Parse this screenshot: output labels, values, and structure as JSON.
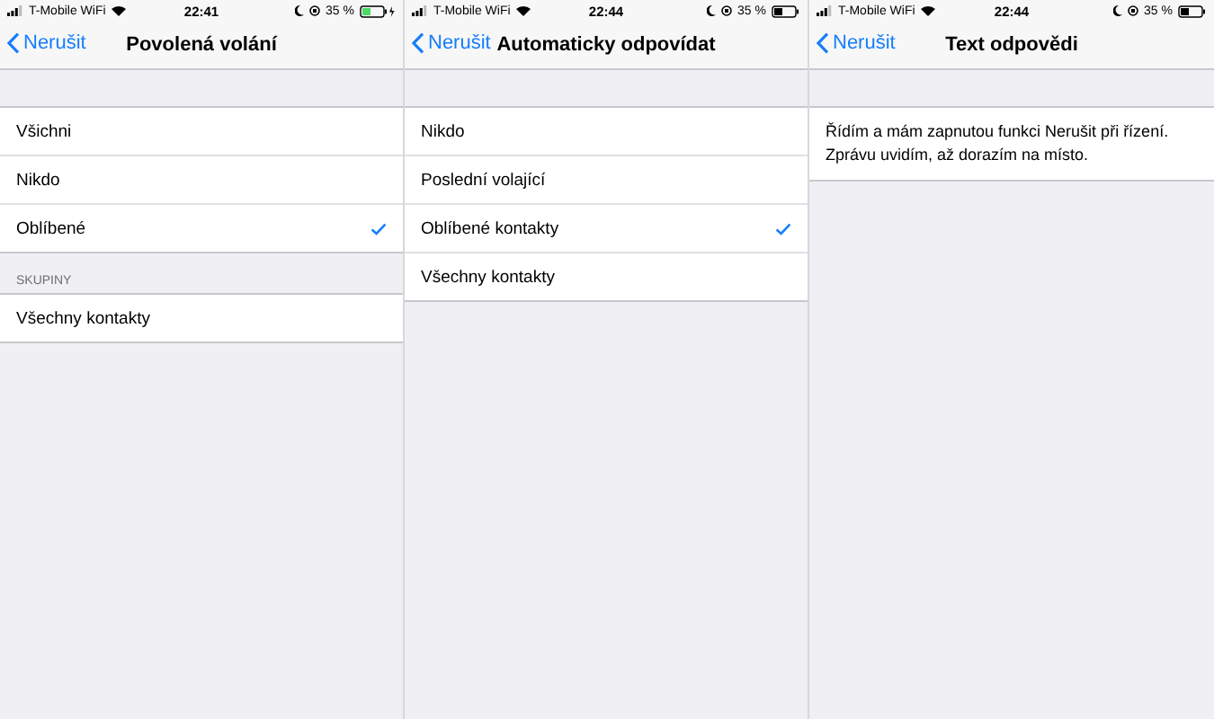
{
  "panels": [
    {
      "status_bar": {
        "carrier": "T-Mobile WiFi",
        "time": "22:41",
        "battery": "35 %",
        "charging": true
      },
      "nav": {
        "back": "Nerušit",
        "title": "Povolená volání"
      },
      "sections": [
        {
          "kind": "list",
          "rows": [
            {
              "label": "Všichni",
              "selected": false
            },
            {
              "label": "Nikdo",
              "selected": false
            },
            {
              "label": "Oblíbené",
              "selected": true
            }
          ]
        },
        {
          "kind": "list",
          "header": "SKUPINY",
          "rows": [
            {
              "label": "Všechny kontakty",
              "selected": false
            }
          ]
        }
      ]
    },
    {
      "status_bar": {
        "carrier": "T-Mobile WiFi",
        "time": "22:44",
        "battery": "35 %",
        "charging": false
      },
      "nav": {
        "back": "Nerušit",
        "title": "Automaticky odpovídat"
      },
      "sections": [
        {
          "kind": "list",
          "rows": [
            {
              "label": "Nikdo",
              "selected": false
            },
            {
              "label": "Poslední volající",
              "selected": false
            },
            {
              "label": "Oblíbené kontakty",
              "selected": true
            },
            {
              "label": "Všechny kontakty",
              "selected": false
            }
          ]
        }
      ]
    },
    {
      "status_bar": {
        "carrier": "T-Mobile WiFi",
        "time": "22:44",
        "battery": "35 %",
        "charging": false
      },
      "nav": {
        "back": "Nerušit",
        "title": "Text odpovědi"
      },
      "sections": [
        {
          "kind": "text",
          "text": "Řídím a mám zapnutou funkci Nerušit při řízení. Zprávu uvidím, až dorazím na místo."
        }
      ]
    }
  ]
}
